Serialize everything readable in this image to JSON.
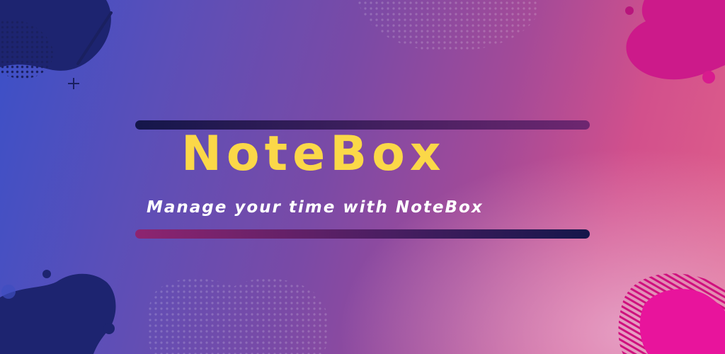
{
  "app": {
    "title": "NoteBox",
    "tagline": "Manage your time with NoteBox"
  },
  "colors": {
    "title": "#fbd848",
    "tagline": "#ffffff",
    "bar_dark": "#14164a",
    "bar_magenta": "#8e2470",
    "blob_navy": "#1d2470",
    "blob_pink": "#e0149a"
  },
  "icons": [
    "plus-sparkle-icon"
  ]
}
